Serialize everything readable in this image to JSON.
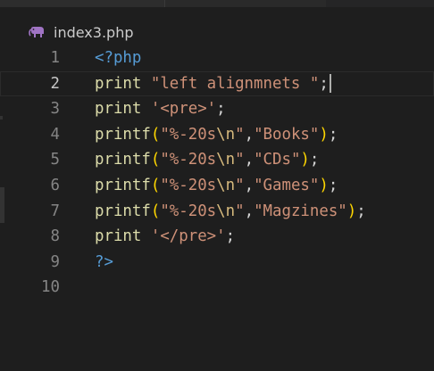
{
  "tab": {
    "filename": "index3.php",
    "icon": "php-elephant-icon",
    "icon_color": "#a074c4"
  },
  "editor": {
    "lines": [
      {
        "num": "1",
        "tokens": [
          {
            "t": "<?php",
            "c": "tag"
          }
        ]
      },
      {
        "num": "2",
        "current": true,
        "tokens": [
          {
            "t": "print",
            "c": "kw"
          },
          {
            "t": " ",
            "c": "punc"
          },
          {
            "t": "\"left alignmnets \"",
            "c": "str"
          },
          {
            "t": ";",
            "c": "punc"
          }
        ],
        "cursor": true
      },
      {
        "num": "3",
        "tokens": [
          {
            "t": "print",
            "c": "kw"
          },
          {
            "t": " ",
            "c": "punc"
          },
          {
            "t": "'<pre>'",
            "c": "str"
          },
          {
            "t": ";",
            "c": "punc"
          }
        ]
      },
      {
        "num": "4",
        "tokens": [
          {
            "t": "printf",
            "c": "fn"
          },
          {
            "t": "(",
            "c": "paren"
          },
          {
            "t": "\"%-20s",
            "c": "str"
          },
          {
            "t": "\\n",
            "c": "esc"
          },
          {
            "t": "\"",
            "c": "str"
          },
          {
            "t": ",",
            "c": "punc"
          },
          {
            "t": "\"Books\"",
            "c": "str"
          },
          {
            "t": ")",
            "c": "paren"
          },
          {
            "t": ";",
            "c": "punc"
          }
        ]
      },
      {
        "num": "5",
        "tokens": [
          {
            "t": "printf",
            "c": "fn"
          },
          {
            "t": "(",
            "c": "paren"
          },
          {
            "t": "\"%-20s",
            "c": "str"
          },
          {
            "t": "\\n",
            "c": "esc"
          },
          {
            "t": "\"",
            "c": "str"
          },
          {
            "t": ",",
            "c": "punc"
          },
          {
            "t": "\"CDs\"",
            "c": "str"
          },
          {
            "t": ")",
            "c": "paren"
          },
          {
            "t": ";",
            "c": "punc"
          }
        ]
      },
      {
        "num": "6",
        "tokens": [
          {
            "t": "printf",
            "c": "fn"
          },
          {
            "t": "(",
            "c": "paren"
          },
          {
            "t": "\"%-20s",
            "c": "str"
          },
          {
            "t": "\\n",
            "c": "esc"
          },
          {
            "t": "\"",
            "c": "str"
          },
          {
            "t": ",",
            "c": "punc"
          },
          {
            "t": "\"Games\"",
            "c": "str"
          },
          {
            "t": ")",
            "c": "paren"
          },
          {
            "t": ";",
            "c": "punc"
          }
        ]
      },
      {
        "num": "7",
        "tokens": [
          {
            "t": "printf",
            "c": "fn"
          },
          {
            "t": "(",
            "c": "paren"
          },
          {
            "t": "\"%-20s",
            "c": "str"
          },
          {
            "t": "\\n",
            "c": "esc"
          },
          {
            "t": "\"",
            "c": "str"
          },
          {
            "t": ",",
            "c": "punc"
          },
          {
            "t": "\"Magzines\"",
            "c": "str"
          },
          {
            "t": ")",
            "c": "paren"
          },
          {
            "t": ";",
            "c": "punc"
          }
        ]
      },
      {
        "num": "8",
        "tokens": [
          {
            "t": "print",
            "c": "kw"
          },
          {
            "t": " ",
            "c": "punc"
          },
          {
            "t": "'</pre>'",
            "c": "str"
          },
          {
            "t": ";",
            "c": "punc"
          }
        ]
      },
      {
        "num": "9",
        "tokens": [
          {
            "t": "?>",
            "c": "tag"
          }
        ]
      },
      {
        "num": "10",
        "tokens": []
      }
    ]
  },
  "colors": {
    "background": "#1e1e1e",
    "tag": "#569cd6",
    "keyword": "#dcdcaa",
    "string": "#ce9178",
    "escape": "#d7ba7d",
    "bracket": "#ffd700",
    "punctuation": "#d4d4d4",
    "line_number": "#858585",
    "line_number_active": "#c6c6c6"
  }
}
